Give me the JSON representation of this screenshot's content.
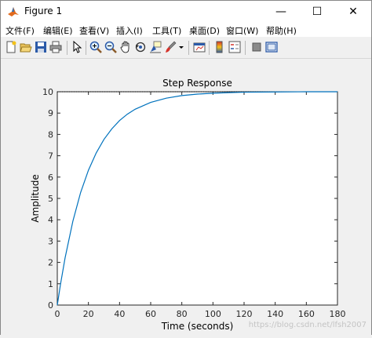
{
  "window": {
    "title": "Figure 1",
    "minimize_glyph": "—",
    "maximize_glyph": "☐",
    "close_glyph": "✕"
  },
  "menu": {
    "items": [
      "文件(F)",
      "编辑(E)",
      "查看(V)",
      "插入(I)",
      "工具(T)",
      "桌面(D)",
      "窗口(W)",
      "帮助(H)"
    ]
  },
  "toolbar": {
    "icons": [
      "new-figure-icon",
      "open-file-icon",
      "save-icon",
      "print-icon",
      "select-arrow-icon",
      "zoom-in-icon",
      "zoom-out-icon",
      "pan-hand-icon",
      "rotate-3d-icon",
      "data-cursor-icon",
      "brush-icon",
      "brush-dropdown-icon",
      "link-plot-icon",
      "colorbar-icon",
      "legend-icon",
      "hide-plot-tools-icon",
      "show-plot-tools-icon"
    ]
  },
  "chart_data": {
    "type": "line",
    "title": "Step Response",
    "xlabel": "Time (seconds)",
    "ylabel": "Amplitude",
    "xlim": [
      0,
      180
    ],
    "ylim": [
      0,
      10
    ],
    "xticks": [
      0,
      20,
      40,
      60,
      80,
      100,
      120,
      140,
      160,
      180
    ],
    "yticks": [
      0,
      1,
      2,
      3,
      4,
      5,
      6,
      7,
      8,
      9,
      10
    ],
    "grid": false,
    "steady_state": 10,
    "series": [
      {
        "color": "#0072bd",
        "x": [
          0,
          2,
          5,
          10,
          15,
          20,
          25,
          30,
          35,
          40,
          45,
          50,
          60,
          70,
          80,
          90,
          100,
          110,
          120,
          140,
          160,
          180
        ],
        "y": [
          0,
          0.95,
          2.21,
          3.93,
          5.28,
          6.32,
          7.13,
          7.77,
          8.26,
          8.65,
          8.95,
          9.18,
          9.5,
          9.7,
          9.82,
          9.89,
          9.93,
          9.96,
          9.98,
          9.99,
          10.0,
          10.0
        ]
      }
    ]
  },
  "watermark": "https://blog.csdn.net/lfsh2007"
}
